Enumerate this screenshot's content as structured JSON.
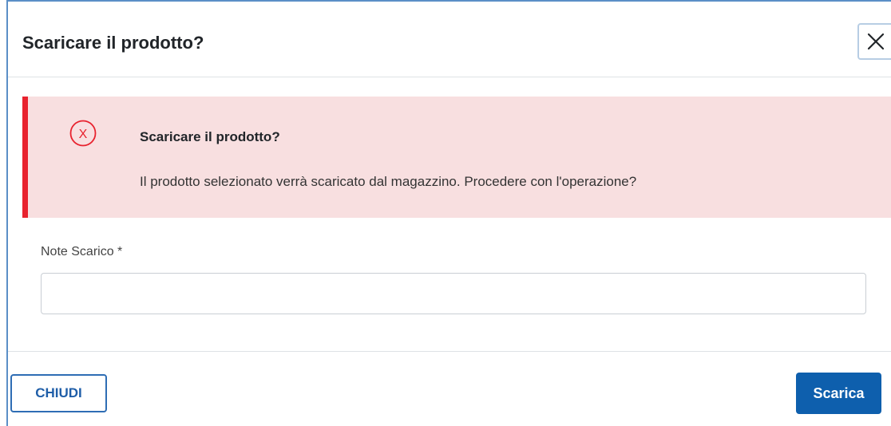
{
  "dialog": {
    "title": "Scaricare il prodotto?",
    "close_icon": "close-icon"
  },
  "alert": {
    "icon": "error-circle-icon",
    "accent_color": "#e8222e",
    "background_color": "#f8dfe0",
    "title": "Scaricare il prodotto?",
    "message": "Il prodotto selezionato verrà scaricato dal magazzino. Procedere con l'operazione?"
  },
  "form": {
    "note_label": "Note Scarico *",
    "note_value": "",
    "note_placeholder": ""
  },
  "footer": {
    "close_label": "CHIUDI",
    "confirm_label": "Scarica",
    "primary_color": "#0e5fad"
  }
}
